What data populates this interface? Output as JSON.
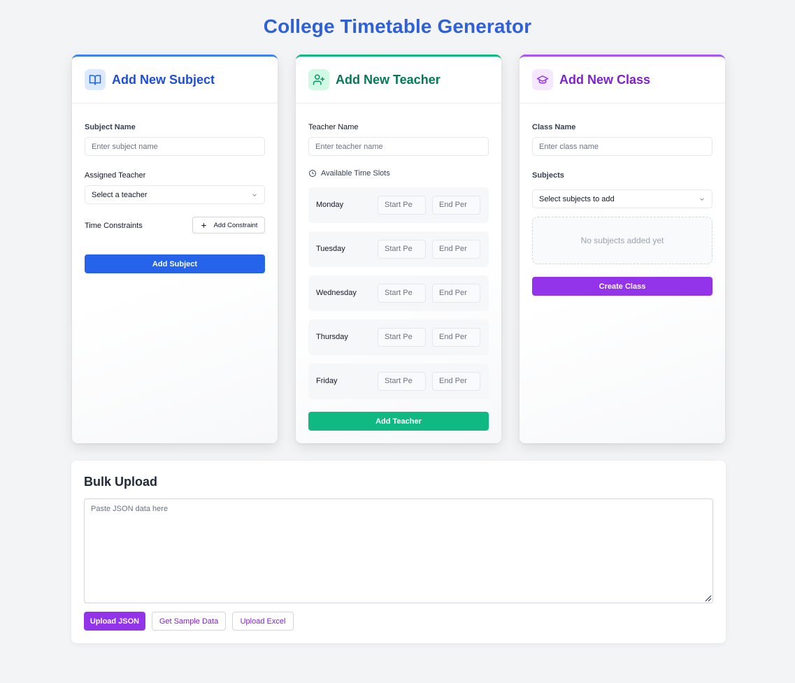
{
  "page": {
    "title": "College Timetable Generator"
  },
  "subject_card": {
    "title": "Add New Subject",
    "icon": "book-open-icon",
    "name_label": "Subject Name",
    "name_placeholder": "Enter subject name",
    "teacher_label": "Assigned Teacher",
    "teacher_select": "Select a teacher",
    "constraints_label": "Time Constraints",
    "add_constraint_label": "Add Constraint",
    "submit_label": "Add Subject",
    "accent": "#3b82f6"
  },
  "teacher_card": {
    "title": "Add New Teacher",
    "icon": "user-plus-icon",
    "name_label": "Teacher Name",
    "name_placeholder": "Enter teacher name",
    "slots_label": "Available Time Slots",
    "days": [
      {
        "day": "Monday",
        "start": "Start Pe",
        "end": "End Per"
      },
      {
        "day": "Tuesday",
        "start": "Start Pe",
        "end": "End Per"
      },
      {
        "day": "Wednesday",
        "start": "Start Pe",
        "end": "End Per"
      },
      {
        "day": "Thursday",
        "start": "Start Pe",
        "end": "End Per"
      },
      {
        "day": "Friday",
        "start": "Start Pe",
        "end": "End Per"
      }
    ],
    "submit_label": "Add Teacher",
    "accent": "#10b981"
  },
  "class_card": {
    "title": "Add New Class",
    "icon": "graduation-cap-icon",
    "name_label": "Class Name",
    "name_placeholder": "Enter class name",
    "subjects_label": "Subjects",
    "subjects_select": "Select subjects to add",
    "empty_text": "No subjects added yet",
    "submit_label": "Create Class",
    "accent": "#a855f7"
  },
  "bulk": {
    "title": "Bulk Upload",
    "placeholder": "Paste JSON data here",
    "upload_json_label": "Upload JSON",
    "sample_label": "Get Sample Data",
    "excel_label": "Upload Excel"
  }
}
